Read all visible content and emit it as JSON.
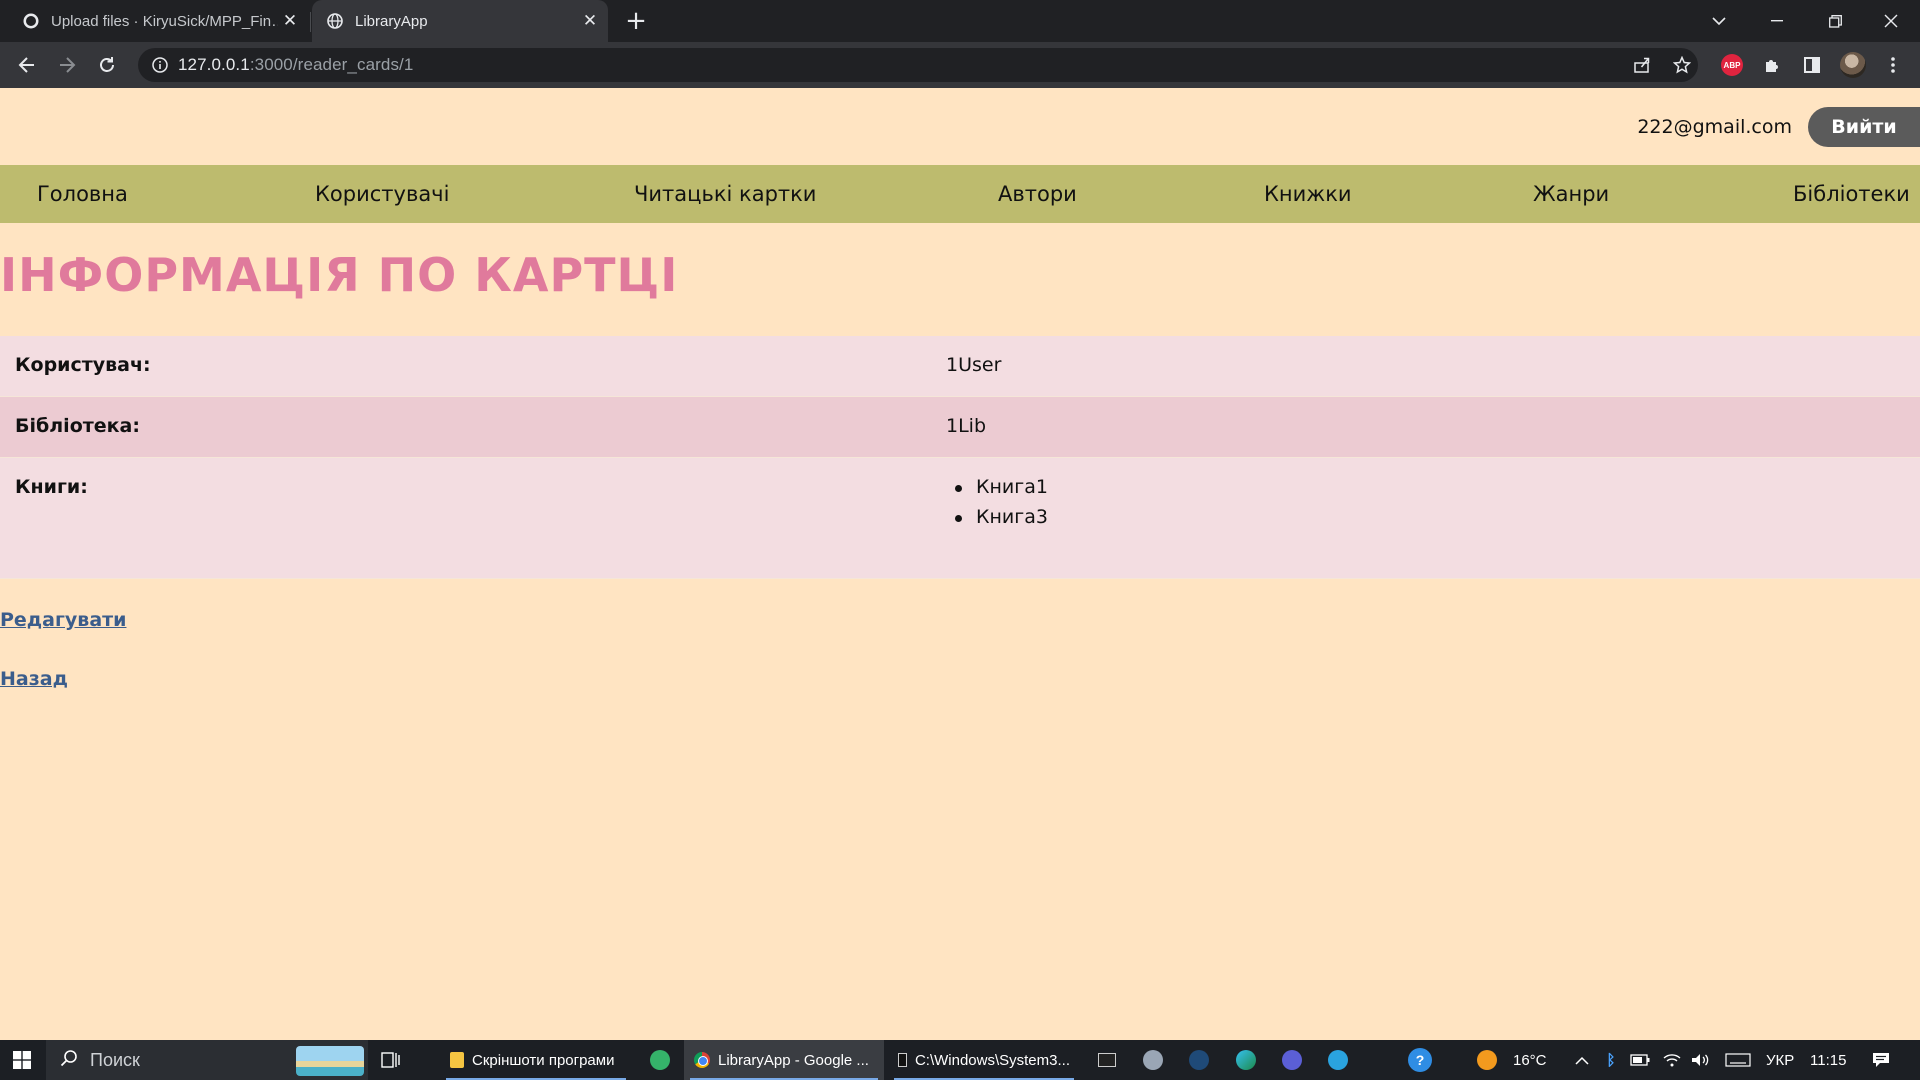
{
  "browser": {
    "tabs": [
      {
        "title": "Upload files · KiryuSick/MPP_Fin…",
        "active": false
      },
      {
        "title": "LibraryApp",
        "active": true
      }
    ],
    "url_host": "127.0.0.1",
    "url_path": ":3000/reader_cards/1"
  },
  "header": {
    "email": "222@gmail.com",
    "logout_label": "Вийти"
  },
  "nav": {
    "items": [
      "Головна",
      "Користувачі",
      "Читацькі картки",
      "Автори",
      "Книжки",
      "Жанри",
      "Бібліотеки"
    ]
  },
  "main": {
    "title": "ІНФОРМАЦІЯ ПО КАРТЦІ",
    "rows": {
      "user_label": "Користувач:",
      "user_value": "1User",
      "library_label": "Бібліотека:",
      "library_value": "1Lib",
      "books_label": "Книги:",
      "books": [
        "Книга1",
        "Книга3"
      ]
    },
    "edit_link": "Редагувати",
    "back_link": "Назад"
  },
  "taskbar": {
    "search_placeholder": "Поиск",
    "apps": [
      {
        "label": "Скріншоти програми"
      },
      {
        "label": "LibraryApp - Google ..."
      },
      {
        "label": "C:\\Windows\\System3..."
      }
    ],
    "weather": "16°C",
    "language": "УКР",
    "time": "11:15"
  },
  "colors": {
    "page_bg": "#ffe4c2",
    "nav_bg": "#bdbb6e",
    "heading": "#e07a9c",
    "row_light": "#f3dde1",
    "row_dark": "#eccbd2",
    "link": "#3b5d8c",
    "logout_bg": "#5b5b5b"
  }
}
